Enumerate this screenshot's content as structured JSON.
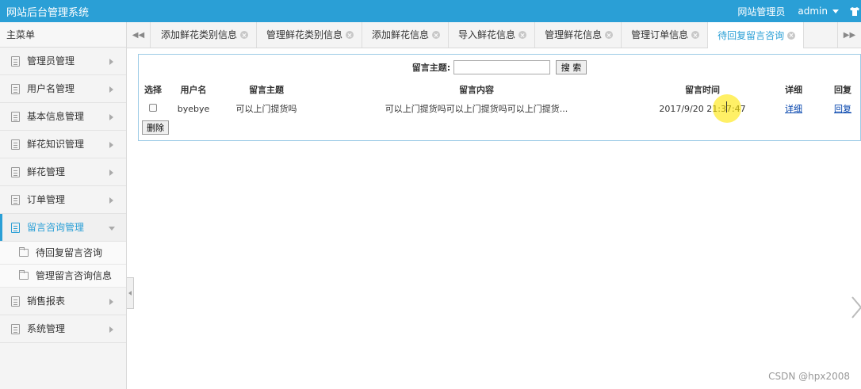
{
  "topbar": {
    "title": "网站后台管理系统",
    "role": "网站管理员",
    "user": "admin",
    "bg_color": "#2a9fd6"
  },
  "sidebar": {
    "header": "主菜单",
    "items": [
      {
        "label": "管理员管理"
      },
      {
        "label": "用户名管理"
      },
      {
        "label": "基本信息管理"
      },
      {
        "label": "鲜花知识管理"
      },
      {
        "label": "鲜花管理"
      },
      {
        "label": "订单管理"
      },
      {
        "label": "留言咨询管理",
        "expanded": true
      },
      {
        "label": "销售报表"
      },
      {
        "label": "系统管理"
      }
    ],
    "sub_items": [
      {
        "label": "待回复留言咨询"
      },
      {
        "label": "管理留言咨询信息"
      }
    ]
  },
  "tabs": [
    {
      "label": "添加鲜花类别信息"
    },
    {
      "label": "管理鲜花类别信息"
    },
    {
      "label": "添加鲜花信息"
    },
    {
      "label": "导入鲜花信息"
    },
    {
      "label": "管理鲜花信息"
    },
    {
      "label": "管理订单信息"
    },
    {
      "label": "待回复留言咨询",
      "active": true
    }
  ],
  "search": {
    "label": "留言主题:",
    "value": "",
    "button": "搜 索"
  },
  "table": {
    "headers": [
      "选择",
      "用户名",
      "留言主题",
      "留言内容",
      "留言时间",
      "详细",
      "回复"
    ],
    "rows": [
      {
        "username": "byebye",
        "subject": "可以上门提货吗",
        "content": "可以上门提货吗可以上门提货吗可以上门提货...",
        "time": "2017/9/20 21:37:47",
        "detail": "详细",
        "reply": "回复"
      }
    ]
  },
  "delete_button": "删除",
  "watermark": "CSDN @hpx2008"
}
